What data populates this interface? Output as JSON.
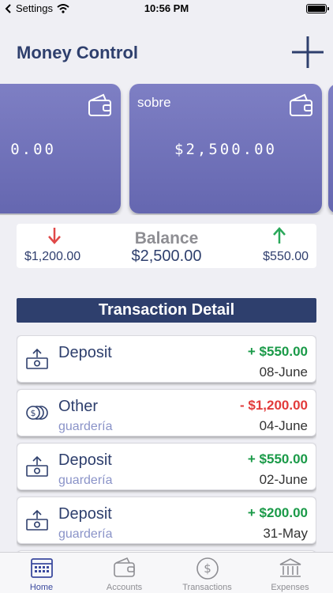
{
  "status_bar": {
    "back_label": "Settings",
    "time": "10:56 PM"
  },
  "app": {
    "title": "Money Control"
  },
  "cards": [
    {
      "name": "",
      "amount": "0.00"
    },
    {
      "name": "sobre",
      "amount": "$2,500.00"
    }
  ],
  "balance": {
    "label": "Balance",
    "total": "$2,500.00",
    "outgoing": "$1,200.00",
    "incoming": "$550.00"
  },
  "section": {
    "title": "Transaction Detail"
  },
  "transactions": [
    {
      "title": "Deposit",
      "subtitle": "",
      "amount": "+ $550.00",
      "date": "08-June",
      "icon": "deposit-icon",
      "type": "pos"
    },
    {
      "title": "Other",
      "subtitle": "guardería",
      "amount": "- $1,200.00",
      "date": "04-June",
      "icon": "coins-icon",
      "type": "neg"
    },
    {
      "title": "Deposit",
      "subtitle": "guardería",
      "amount": "+ $550.00",
      "date": "02-June",
      "icon": "deposit-icon",
      "type": "pos"
    },
    {
      "title": "Deposit",
      "subtitle": "guardería",
      "amount": "+ $200.00",
      "date": "31-May",
      "icon": "deposit-icon",
      "type": "pos"
    }
  ],
  "tabs": [
    {
      "label": "Home",
      "icon": "calendar-icon",
      "active": true
    },
    {
      "label": "Accounts",
      "icon": "wallet-icon"
    },
    {
      "label": "Transactions",
      "icon": "dollar-circle-icon"
    },
    {
      "label": "Expenses",
      "icon": "bank-icon"
    }
  ],
  "colors": {
    "primary": "#2e3f6d",
    "card": "#7373bb",
    "positive": "#1a9a48",
    "negative": "#e23b3b",
    "tab_active": "#3b4a9e"
  }
}
